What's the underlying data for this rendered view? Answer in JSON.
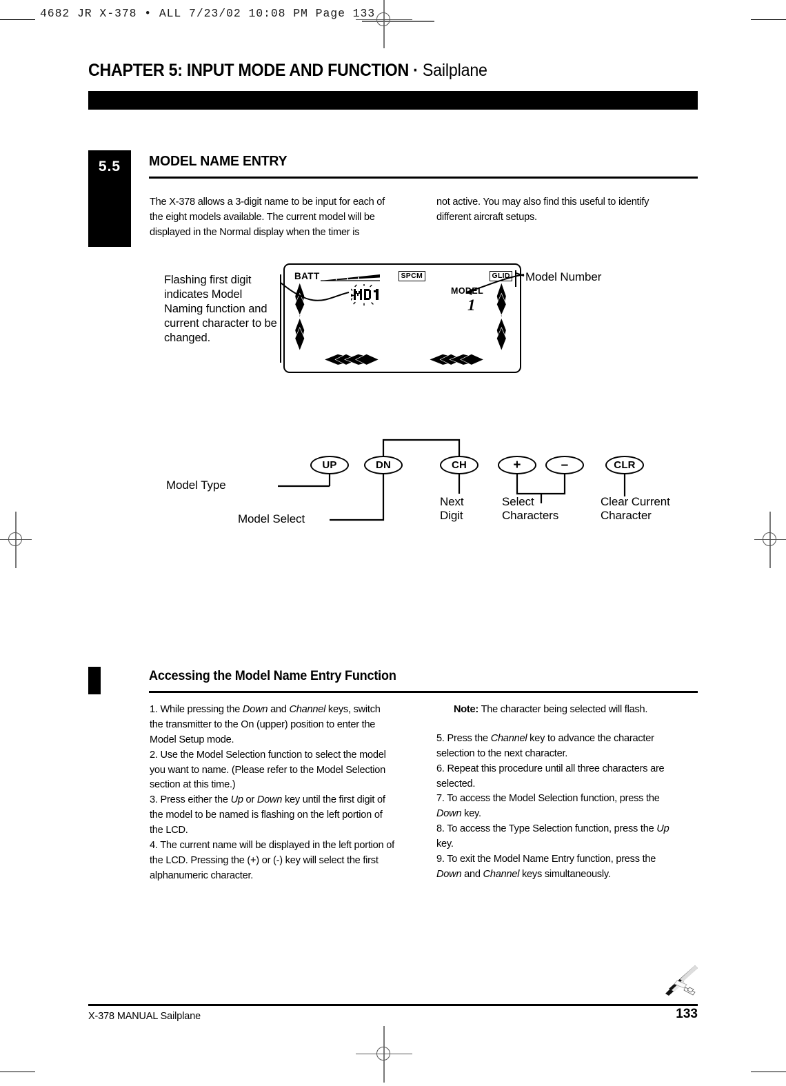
{
  "slug": {
    "text": "4682 JR X-378 • ALL  7/23/02  10:08 PM  Page 133"
  },
  "header": {
    "chapter_title_main": "CHAPTER 5: INPUT MODE AND FUNCTION",
    "chapter_title_separator": " · ",
    "chapter_title_sub": "Sailplane"
  },
  "section": {
    "number": "5.5",
    "heading": "MODEL NAME ENTRY",
    "intro_left": "The X-378 allows a 3-digit name to be input for each of the eight models available. The current model will be displayed in the Normal display when the timer is",
    "intro_right": "not active. You may also find this useful to identify different aircraft setups."
  },
  "lcd": {
    "batt_label": "BATT",
    "spcm_label": "SPCM",
    "glid_label": "GLID",
    "model_label": "MODEL",
    "model_number": "1",
    "name_value": "MD1"
  },
  "callouts": {
    "left": "Flashing first digit indicates Model Naming function and current character to be changed.",
    "right": "Model Number"
  },
  "key_diagram": {
    "keys": [
      {
        "label": "UP",
        "name": "up-key"
      },
      {
        "label": "DN",
        "name": "dn-key"
      },
      {
        "label": "CH",
        "name": "ch-key"
      },
      {
        "label": "+",
        "name": "plus-key"
      },
      {
        "label": "–",
        "name": "minus-key"
      },
      {
        "label": "CLR",
        "name": "clr-key"
      }
    ],
    "labels": {
      "model_type": "Model Type",
      "model_select": "Model Select",
      "next_digit_line1": "Next",
      "next_digit_line2": "Digit",
      "select_characters_line1": "Select",
      "select_characters_line2": "Characters",
      "clear_current_line1": "Clear Current",
      "clear_current_line2": "Character"
    }
  },
  "subsection": {
    "heading": "Accessing the Model Name Entry Function",
    "steps_left": [
      "1. While pressing the Down and Channel keys, switch the transmitter to the On (upper) position to enter the Model Setup mode.",
      "2. Use the Model Selection function to select the model you want to name. (Please refer to the Model Selection section at this time.)",
      "3. Press either the Up or Down key until the first digit of the model to be named is  flashing on the left portion of the LCD.",
      "4. The current name will be displayed in the left portion of the LCD. Pressing the (+) or (-) key will select the first alphanumeric character."
    ],
    "note_label": "Note:",
    "note_text": " The character being selected will flash.",
    "steps_right": [
      "5. Press the Channel key to advance the character selection to the next character.",
      "6. Repeat this procedure until all three characters are selected.",
      "7. To access the Model Selection function, press the Down key.",
      "8. To access the Type Selection function, press the Up key.",
      "9. To exit the Model Name Entry function, press the Down and Channel keys simultaneously."
    ]
  },
  "footer": {
    "left": "X-378 MANUAL  Sailplane",
    "page_number": "133"
  }
}
